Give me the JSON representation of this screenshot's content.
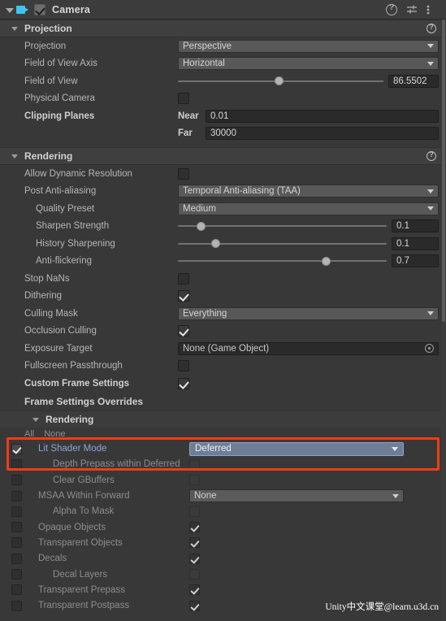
{
  "header": {
    "title": "Camera",
    "enabled": true,
    "icons": [
      "help-icon",
      "preset-icon",
      "more-menu-icon"
    ]
  },
  "projection": {
    "title": "Projection",
    "rows": {
      "projection": {
        "label": "Projection",
        "value": "Perspective"
      },
      "fov_axis": {
        "label": "Field of View Axis",
        "value": "Horizontal"
      },
      "fov": {
        "label": "Field of View",
        "value": "86.5502",
        "slider_pct": 47
      },
      "physical_camera": {
        "label": "Physical Camera",
        "checked": false
      },
      "clipping_planes": {
        "label": "Clipping Planes",
        "near_label": "Near",
        "near": "0.01",
        "far_label": "Far",
        "far": "30000"
      }
    }
  },
  "rendering": {
    "title": "Rendering",
    "rows": {
      "allow_dynamic_resolution": {
        "label": "Allow Dynamic Resolution",
        "checked": false
      },
      "post_aa": {
        "label": "Post Anti-aliasing",
        "value": "Temporal Anti-aliasing (TAA)"
      },
      "quality_preset": {
        "label": "Quality Preset",
        "value": "Medium"
      },
      "sharpen_strength": {
        "label": "Sharpen Strength",
        "value": "0.1",
        "slider_pct": 10
      },
      "history_sharpening": {
        "label": "History Sharpening",
        "value": "0.1",
        "slider_pct": 18
      },
      "anti_flickering": {
        "label": "Anti-flickering",
        "value": "0.7",
        "slider_pct": 70
      },
      "stop_nans": {
        "label": "Stop NaNs",
        "checked": false
      },
      "dithering": {
        "label": "Dithering",
        "checked": true
      },
      "culling_mask": {
        "label": "Culling Mask",
        "value": "Everything"
      },
      "occlusion_culling": {
        "label": "Occlusion Culling",
        "checked": true
      },
      "exposure_target": {
        "label": "Exposure Target",
        "value": "None (Game Object)"
      },
      "fullscreen_passthrough": {
        "label": "Fullscreen Passthrough",
        "checked": false
      },
      "custom_frame_settings": {
        "label": "Custom Frame Settings",
        "checked": true
      }
    }
  },
  "frame_settings": {
    "title": "Frame Settings Overrides",
    "sub_title": "Rendering",
    "all_label": "All",
    "none_label": "None",
    "items": [
      {
        "label": "Lit Shader Mode",
        "override": true,
        "control": "dropdown-accent",
        "value": "Deferred",
        "indent": 0,
        "highlight": true
      },
      {
        "label": "Depth Prepass within Deferred",
        "override": false,
        "control": "checkbox",
        "checked": false,
        "indent": 1,
        "highlight": false
      },
      {
        "label": "Clear GBuffers",
        "override": false,
        "control": "checkbox",
        "checked": false,
        "indent": 1,
        "highlight": false
      },
      {
        "label": "MSAA Within Forward",
        "override": false,
        "control": "dropdown",
        "value": "None",
        "indent": 0,
        "highlight": false
      },
      {
        "label": "Alpha To Mask",
        "override": false,
        "control": "checkbox",
        "checked": false,
        "indent": 1,
        "highlight": false
      },
      {
        "label": "Opaque Objects",
        "override": false,
        "control": "checkbox",
        "checked": true,
        "indent": 0,
        "highlight": false
      },
      {
        "label": "Transparent Objects",
        "override": false,
        "control": "checkbox",
        "checked": true,
        "indent": 0,
        "highlight": false
      },
      {
        "label": "Decals",
        "override": false,
        "control": "checkbox",
        "checked": true,
        "indent": 0,
        "highlight": false
      },
      {
        "label": "Decal Layers",
        "override": false,
        "control": "checkbox",
        "checked": false,
        "indent": 1,
        "highlight": false
      },
      {
        "label": "Transparent Prepass",
        "override": false,
        "control": "checkbox",
        "checked": true,
        "indent": 0,
        "highlight": false
      },
      {
        "label": "Transparent Postpass",
        "override": false,
        "control": "checkbox",
        "checked": true,
        "indent": 0,
        "highlight": false
      }
    ]
  },
  "annotation": {
    "highlight_color": "#f03c14"
  },
  "watermark": {
    "text": "Unity中文课堂@learn.u3d.cn"
  }
}
